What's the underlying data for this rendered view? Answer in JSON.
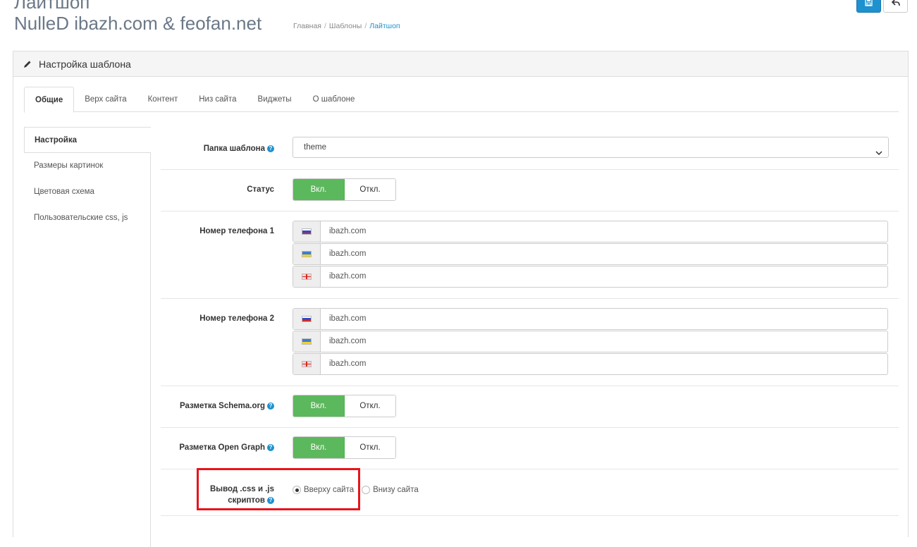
{
  "header": {
    "title_top": "Лайтшоп",
    "title_sub": "NulleD ibazh.com & feofan.net",
    "breadcrumb": [
      "Главная",
      "Шаблоны",
      "Лайтшоп"
    ]
  },
  "panel": {
    "title": "Настройка шаблона",
    "tabs": [
      "Общие",
      "Верх сайта",
      "Контент",
      "Низ сайта",
      "Виджеты",
      "О шаблоне"
    ],
    "leftnav": [
      "Настройка",
      "Размеры картинок",
      "Цветовая схема",
      "Пользовательские css, js"
    ]
  },
  "form": {
    "folder": {
      "label": "Папка шаблона",
      "value": "theme"
    },
    "status": {
      "label": "Статус",
      "on": "Вкл.",
      "off": "Откл."
    },
    "phone1": {
      "label": "Номер телефона 1",
      "values": [
        "ibazh.com",
        "ibazh.com",
        "ibazh.com"
      ]
    },
    "phone2": {
      "label": "Номер телефона 2",
      "values": [
        "ibazh.com",
        "ibazh.com",
        "ibazh.com"
      ]
    },
    "schema": {
      "label": "Разметка Schema.org",
      "on": "Вкл.",
      "off": "Откл."
    },
    "og": {
      "label": "Разметка Open Graph",
      "on": "Вкл.",
      "off": "Откл."
    },
    "output": {
      "label_line1": "Вывод .css и .js",
      "label_line2": "скриптов",
      "opt_top": "Вверху сайта",
      "opt_bottom": "Внизу сайта",
      "selected": "top"
    }
  },
  "colors": {
    "primary": "#1e91cf",
    "success": "#5cb85c",
    "highlight": "#e8141b"
  },
  "icons": {
    "save": "save-icon",
    "back": "reply-icon",
    "heading": "pencil-icon",
    "help": "question-circle-icon"
  }
}
